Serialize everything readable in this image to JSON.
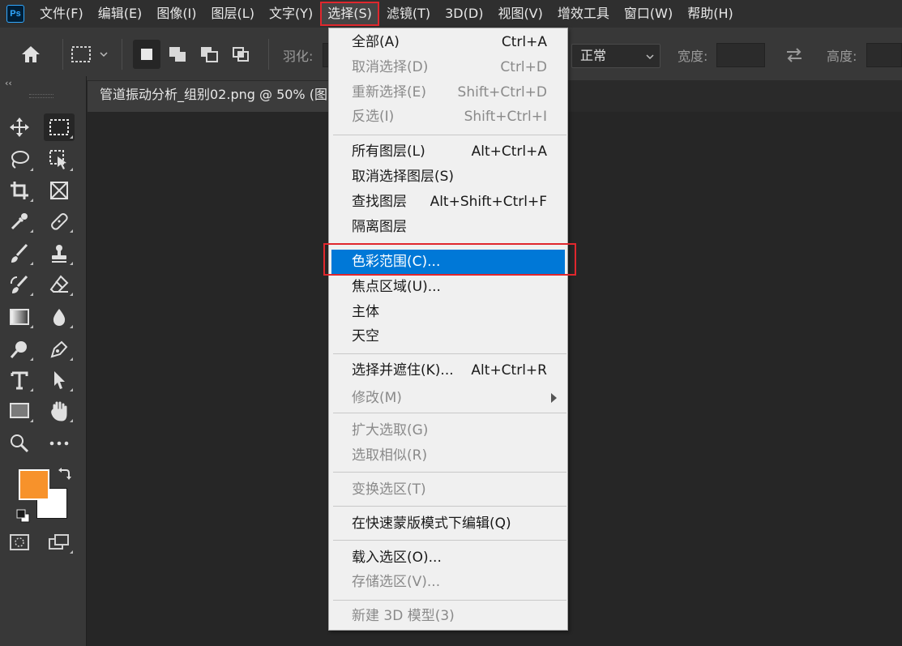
{
  "menubar": {
    "logo": "Ps",
    "items": [
      "文件(F)",
      "编辑(E)",
      "图像(I)",
      "图层(L)",
      "文字(Y)",
      "选择(S)",
      "滤镜(T)",
      "3D(D)",
      "视图(V)",
      "增效工具",
      "窗口(W)",
      "帮助(H)"
    ],
    "active_index": 5
  },
  "options": {
    "feather_label": "羽化:",
    "style_value": "正常",
    "width_label": "宽度:",
    "height_label": "高度:"
  },
  "document": {
    "tab_title": "管道振动分析_组别02.png @ 50% (图"
  },
  "toolbar": {
    "collapse": "‹‹",
    "foreground_color": "#f7922b",
    "background_color": "#ffffff"
  },
  "dropdown": {
    "items": [
      {
        "label": "全部(A)",
        "shortcut": "Ctrl+A",
        "disabled": false
      },
      {
        "label": "取消选择(D)",
        "shortcut": "Ctrl+D",
        "disabled": true
      },
      {
        "label": "重新选择(E)",
        "shortcut": "Shift+Ctrl+D",
        "disabled": true
      },
      {
        "label": "反选(I)",
        "shortcut": "Shift+Ctrl+I",
        "disabled": true
      },
      {
        "label": "所有图层(L)",
        "shortcut": "Alt+Ctrl+A",
        "disabled": false
      },
      {
        "label": "取消选择图层(S)",
        "shortcut": "",
        "disabled": false
      },
      {
        "label": "查找图层",
        "shortcut": "Alt+Shift+Ctrl+F",
        "disabled": false
      },
      {
        "label": "隔离图层",
        "shortcut": "",
        "disabled": false
      },
      {
        "label": "色彩范围(C)...",
        "shortcut": "",
        "disabled": false,
        "highlighted": true
      },
      {
        "label": "焦点区域(U)...",
        "shortcut": "",
        "disabled": false
      },
      {
        "label": "主体",
        "shortcut": "",
        "disabled": false
      },
      {
        "label": "天空",
        "shortcut": "",
        "disabled": false
      },
      {
        "label": "选择并遮住(K)...",
        "shortcut": "Alt+Ctrl+R",
        "disabled": false
      },
      {
        "label": "修改(M)",
        "shortcut": "",
        "disabled": true,
        "submenu": true
      },
      {
        "label": "扩大选取(G)",
        "shortcut": "",
        "disabled": true
      },
      {
        "label": "选取相似(R)",
        "shortcut": "",
        "disabled": true
      },
      {
        "label": "变换选区(T)",
        "shortcut": "",
        "disabled": true
      },
      {
        "label": "在快速蒙版模式下编辑(Q)",
        "shortcut": "",
        "disabled": false
      },
      {
        "label": "载入选区(O)...",
        "shortcut": "",
        "disabled": false
      },
      {
        "label": "存储选区(V)...",
        "shortcut": "",
        "disabled": true
      },
      {
        "label": "新建 3D 模型(3)",
        "shortcut": "",
        "disabled": true
      }
    ]
  }
}
